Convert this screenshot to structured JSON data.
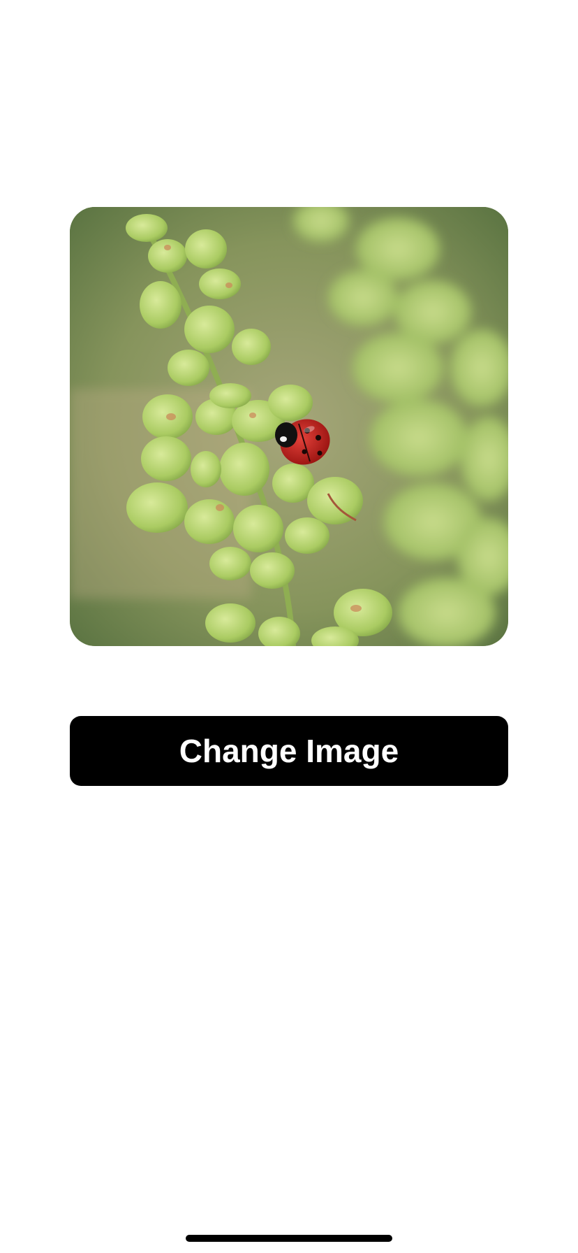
{
  "main": {
    "image_subject": "ladybug-on-green-plant",
    "change_button_label": "Change Image"
  },
  "colors": {
    "button_background": "#000000",
    "button_text": "#ffffff",
    "page_background": "#ffffff",
    "home_indicator": "#000000"
  }
}
